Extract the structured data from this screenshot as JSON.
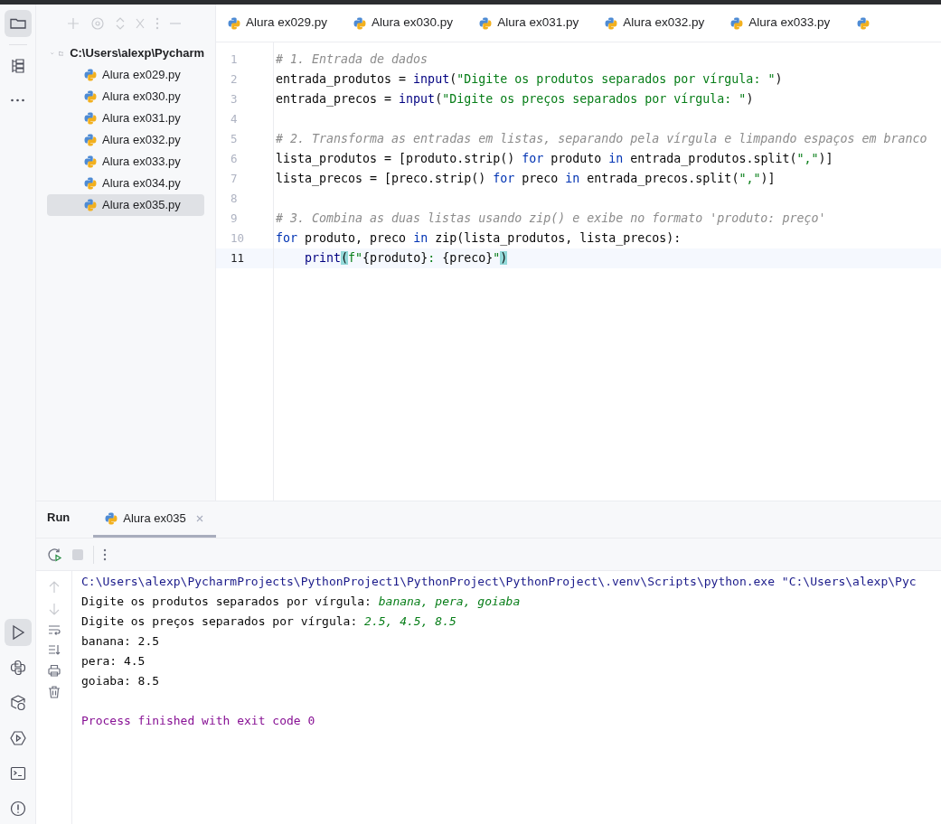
{
  "tool_stripe": {
    "top": [
      {
        "kind": "folder",
        "selected": true
      },
      {
        "kind": "structure",
        "selected": false
      },
      {
        "kind": "more",
        "selected": false
      }
    ],
    "bottom": [
      {
        "kind": "run",
        "selected": true
      },
      {
        "kind": "python",
        "selected": false
      },
      {
        "kind": "packages",
        "selected": false
      },
      {
        "kind": "services",
        "selected": false
      },
      {
        "kind": "terminal",
        "selected": false
      },
      {
        "kind": "problems",
        "selected": false
      }
    ]
  },
  "project": {
    "root": {
      "label": "C:\\Users\\alexp\\Pycharm",
      "expanded": true,
      "children": [
        {
          "label": "Alura ex029.py",
          "selected": false
        },
        {
          "label": "Alura ex030.py",
          "selected": false
        },
        {
          "label": "Alura ex031.py",
          "selected": false
        },
        {
          "label": "Alura ex032.py",
          "selected": false
        },
        {
          "label": "Alura ex033.py",
          "selected": false
        },
        {
          "label": "Alura ex034.py",
          "selected": false
        },
        {
          "label": "Alura ex035.py",
          "selected": true
        }
      ]
    }
  },
  "editor_tabs": [
    {
      "label": "Alura ex029.py"
    },
    {
      "label": "Alura ex030.py"
    },
    {
      "label": "Alura ex031.py"
    },
    {
      "label": "Alura ex032.py"
    },
    {
      "label": "Alura ex033.py"
    }
  ],
  "code": [
    {
      "number": "1",
      "current": false,
      "tokens": [
        {
          "kind": "comment",
          "text": "# 1. Entrada de dados"
        }
      ]
    },
    {
      "number": "2",
      "current": false,
      "tokens": [
        {
          "kind": "plain",
          "text": "entrada_produtos = "
        },
        {
          "kind": "builtin",
          "text": "input"
        },
        {
          "kind": "plain",
          "text": "("
        },
        {
          "kind": "string",
          "text": "\"Digite os produtos separados por vírgula: \""
        },
        {
          "kind": "plain",
          "text": ")"
        }
      ]
    },
    {
      "number": "3",
      "current": false,
      "tokens": [
        {
          "kind": "plain",
          "text": "entrada_precos = "
        },
        {
          "kind": "builtin",
          "text": "input"
        },
        {
          "kind": "plain",
          "text": "("
        },
        {
          "kind": "string",
          "text": "\"Digite os preços separados por vírgula: \""
        },
        {
          "kind": "plain",
          "text": ")"
        }
      ]
    },
    {
      "number": "4",
      "current": false
    },
    {
      "number": "5",
      "current": false,
      "tokens": [
        {
          "kind": "comment",
          "text": "# 2. Transforma as entradas em listas, separando pela vírgula e limpando espaços em branco"
        }
      ]
    },
    {
      "number": "6",
      "current": false,
      "tokens": [
        {
          "kind": "plain",
          "text": "lista_produtos = [produto.strip() "
        },
        {
          "kind": "keyword",
          "text": "for"
        },
        {
          "kind": "plain",
          "text": " produto "
        },
        {
          "kind": "keyword",
          "text": "in"
        },
        {
          "kind": "plain",
          "text": " entrada_produtos.split("
        },
        {
          "kind": "string",
          "text": "\",\""
        },
        {
          "kind": "plain",
          "text": ")]"
        }
      ]
    },
    {
      "number": "7",
      "current": false,
      "tokens": [
        {
          "kind": "plain",
          "text": "lista_precos = [preco.strip() "
        },
        {
          "kind": "keyword",
          "text": "for"
        },
        {
          "kind": "plain",
          "text": " preco "
        },
        {
          "kind": "keyword",
          "text": "in"
        },
        {
          "kind": "plain",
          "text": " entrada_precos.split("
        },
        {
          "kind": "string",
          "text": "\",\""
        },
        {
          "kind": "plain",
          "text": ")]"
        }
      ]
    },
    {
      "number": "8",
      "current": false
    },
    {
      "number": "9",
      "current": false,
      "tokens": [
        {
          "kind": "comment",
          "text": "# 3. Combina as duas listas usando zip() e exibe no formato 'produto: preço'"
        }
      ]
    },
    {
      "number": "10",
      "current": false,
      "tokens": [
        {
          "kind": "keyword",
          "text": "for"
        },
        {
          "kind": "plain",
          "text": " produto, preco "
        },
        {
          "kind": "keyword",
          "text": "in"
        },
        {
          "kind": "plain",
          "text": " zip(lista_produtos, lista_precos):"
        }
      ]
    },
    {
      "number": "11",
      "current": true,
      "tokens": [
        {
          "kind": "builtin",
          "text": "    print"
        },
        {
          "kind": "brace",
          "text": "("
        },
        {
          "kind": "string",
          "text": "f\""
        },
        {
          "kind": "plain",
          "text": "{produto}"
        },
        {
          "kind": "string",
          "text": ": "
        },
        {
          "kind": "plain",
          "text": "{preco}"
        },
        {
          "kind": "string",
          "text": "\""
        },
        {
          "kind": "brace",
          "text": ")"
        }
      ]
    }
  ],
  "run_panel": {
    "title": "Run",
    "tabs": [
      {
        "label": "Alura ex035",
        "selected": true
      }
    ],
    "console": [
      {
        "kind": "command",
        "parts": [
          {
            "input": false,
            "text": "C:\\Users\\alexp\\PycharmProjects\\PythonProject1\\PythonProject\\PythonProject\\.venv\\Scripts\\python.exe \"C:\\Users\\alexp\\Pyc"
          }
        ]
      },
      {
        "kind": "output",
        "parts": [
          {
            "input": false,
            "text": "Digite os produtos separados por vírgula: "
          },
          {
            "input": true,
            "text": "banana, pera, goiaba"
          }
        ]
      },
      {
        "kind": "output",
        "parts": [
          {
            "input": false,
            "text": "Digite os preços separados por vírgula: "
          },
          {
            "input": true,
            "text": "2.5, 4.5, 8.5"
          }
        ]
      },
      {
        "kind": "output",
        "parts": [
          {
            "input": false,
            "text": "banana: 2.5"
          }
        ]
      },
      {
        "kind": "output",
        "parts": [
          {
            "input": false,
            "text": "pera: 4.5"
          }
        ]
      },
      {
        "kind": "output",
        "parts": [
          {
            "input": false,
            "text": "goiaba: 8.5"
          }
        ]
      },
      {
        "kind": "blank"
      },
      {
        "kind": "exit",
        "parts": [
          {
            "input": false,
            "text": "Process finished with exit code 0"
          }
        ]
      }
    ]
  }
}
